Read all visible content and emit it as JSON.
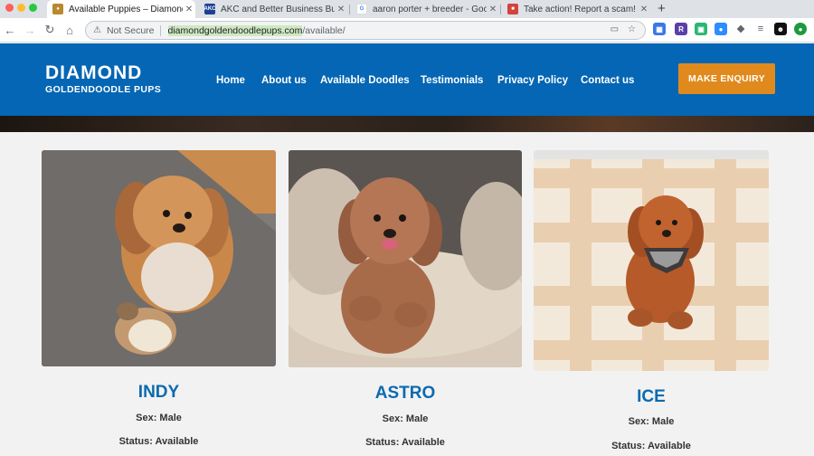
{
  "browser": {
    "tabs": [
      {
        "title": "Available Puppies – Diamond G",
        "favicon": "paw-favicon",
        "active": true
      },
      {
        "title": "AKC and Better Business Burea",
        "favicon": "akc-favicon",
        "favicon_text": "AKC",
        "active": false
      },
      {
        "title": "aaron porter + breeder - Goog",
        "favicon": "google-favicon",
        "favicon_text": "G",
        "active": false
      },
      {
        "title": "Take action! Report a scam! - ",
        "favicon": "report-favicon",
        "active": false
      }
    ],
    "new_tab_label": "+",
    "security_label": "Not Secure",
    "url_host": "diamondgoldendoodlepups.com",
    "url_path": "/available/"
  },
  "site": {
    "logo_main": "DIAMOND",
    "logo_sub": "GOLDENDOODLE PUPS",
    "nav": [
      "Home",
      "About us",
      "Available Doodles",
      "Testimonials",
      "Privacy Policy",
      "Contact us"
    ],
    "cta_label": "MAKE ENQUIRY",
    "colors": {
      "header": "#0466b4",
      "cta": "#e08a1e",
      "name": "#0b6ab0"
    }
  },
  "puppies": [
    {
      "name": "INDY",
      "sex": "Sex: Male",
      "status": "Status: Available"
    },
    {
      "name": "ASTRO",
      "sex": "Sex: Male",
      "status": "Status: Available"
    },
    {
      "name": "ICE",
      "sex": "Sex: Male",
      "status": "Status: Available"
    }
  ]
}
